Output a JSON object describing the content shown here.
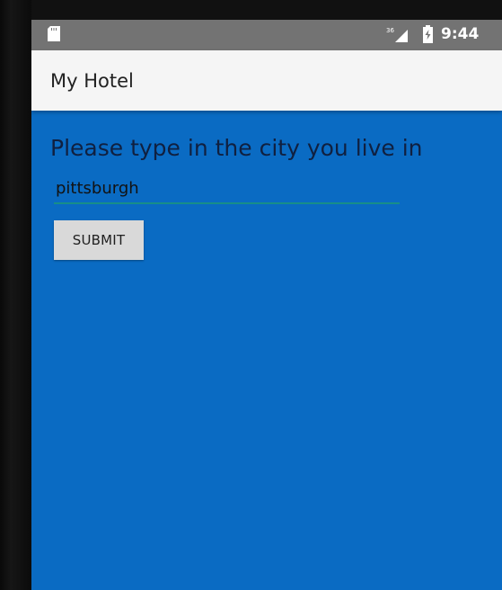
{
  "status_bar": {
    "signal_label": "36",
    "time": "9:44"
  },
  "app_bar": {
    "title": "My Hotel"
  },
  "form": {
    "prompt": "Please type in the city you live in",
    "city_value": "pittsburgh",
    "submit_label": "SUBMIT"
  },
  "colors": {
    "status_bar": "#737373",
    "app_bar": "#f5f5f5",
    "screen_background": "#0a6bc3",
    "input_underline": "#178e89",
    "button": "#d9d9d9"
  },
  "icons": {
    "sim": "sim-card-icon",
    "signal": "signal-strength-icon",
    "battery": "battery-icon"
  }
}
